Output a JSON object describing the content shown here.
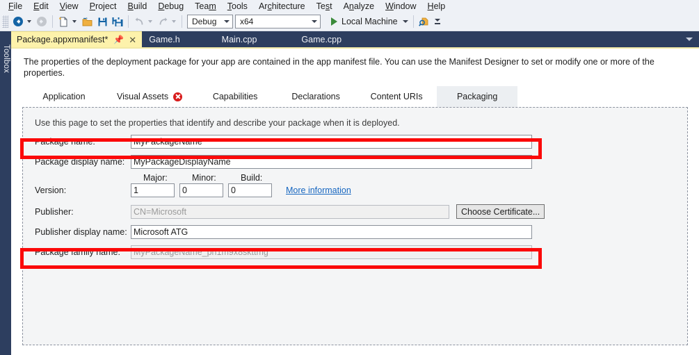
{
  "menubar": {
    "items": [
      {
        "label": "File",
        "accel": "F"
      },
      {
        "label": "Edit",
        "accel": "E"
      },
      {
        "label": "View",
        "accel": "V"
      },
      {
        "label": "Project",
        "accel": "P"
      },
      {
        "label": "Build",
        "accel": "B"
      },
      {
        "label": "Debug",
        "accel": "D"
      },
      {
        "label": "Team",
        "accel": "m"
      },
      {
        "label": "Tools",
        "accel": "T"
      },
      {
        "label": "Architecture",
        "accel": "c"
      },
      {
        "label": "Test",
        "accel": "s"
      },
      {
        "label": "Analyze",
        "accel": "n"
      },
      {
        "label": "Window",
        "accel": "W"
      },
      {
        "label": "Help",
        "accel": "H"
      }
    ]
  },
  "toolbar": {
    "navigate_back_icon": "back-arrow-icon",
    "navigate_forward_icon": "forward-arrow-icon",
    "new_item_icon": "new-item-icon",
    "open_file_icon": "open-folder-icon",
    "save_icon": "save-icon",
    "save_all_icon": "save-all-icon",
    "undo_icon": "undo-icon",
    "redo_icon": "redo-icon",
    "configuration": "Debug",
    "platform": "x64",
    "run_target": "Local Machine",
    "run_icon": "play-icon",
    "find_icon": "find-in-files-icon",
    "overflow_icon": "toolbar-overflow-icon"
  },
  "toolbox": {
    "label": "Toolbox"
  },
  "document_tabs": {
    "items": [
      {
        "label": "Package.appxmanifest*",
        "active": true
      },
      {
        "label": "Game.h",
        "active": false
      },
      {
        "label": "Main.cpp",
        "active": false
      },
      {
        "label": "Game.cpp",
        "active": false
      }
    ],
    "pin_icon": "pin-icon",
    "close_icon": "close-icon",
    "overflow_icon": "tab-overflow-icon"
  },
  "designer": {
    "description": "The properties of the deployment package for your app are contained in the app manifest file. You can use the Manifest Designer to set or modify one or more of the properties.",
    "tabs": [
      {
        "label": "Application",
        "selected": false,
        "error": false
      },
      {
        "label": "Visual Assets",
        "selected": false,
        "error": true
      },
      {
        "label": "Capabilities",
        "selected": false,
        "error": false
      },
      {
        "label": "Declarations",
        "selected": false,
        "error": false
      },
      {
        "label": "Content URIs",
        "selected": false,
        "error": false
      },
      {
        "label": "Packaging",
        "selected": true,
        "error": false
      }
    ],
    "error_badge_icon": "error-badge-icon"
  },
  "packaging": {
    "hint": "Use this page to set the properties that identify and describe your package when it is deployed.",
    "package_name": {
      "label": "Package name:",
      "value": "MyPackageName",
      "readonly": false
    },
    "package_display_name": {
      "label": "Package display name:",
      "value": "MyPackageDisplayName",
      "readonly": false
    },
    "version": {
      "label": "Version:",
      "major_label": "Major:",
      "major": "1",
      "minor_label": "Minor:",
      "minor": "0",
      "build_label": "Build:",
      "build": "0",
      "more_info_link": "More information"
    },
    "publisher": {
      "label": "Publisher:",
      "value": "CN=Microsoft",
      "readonly": true,
      "choose_certificate_button": "Choose Certificate..."
    },
    "publisher_display_name": {
      "label": "Publisher display name:",
      "value": "Microsoft ATG",
      "readonly": false
    },
    "package_family_name": {
      "label": "Package family name:",
      "value": "MyPackageName_ph1m9x8skttmg",
      "readonly": true
    }
  },
  "annotations": {
    "highlight_color": "#fb0909",
    "boxes": [
      {
        "name": "package-name-highlight"
      },
      {
        "name": "package-family-name-highlight"
      }
    ]
  }
}
